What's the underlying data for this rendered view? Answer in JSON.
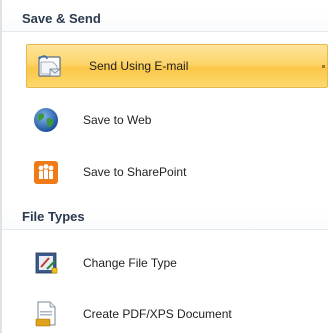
{
  "sections": [
    {
      "title": "Save & Send",
      "items": [
        {
          "label": "Send Using E-mail",
          "icon": "email-icon",
          "selected": true
        },
        {
          "label": "Save to Web",
          "icon": "globe-icon",
          "selected": false
        },
        {
          "label": "Save to SharePoint",
          "icon": "sharepoint-icon",
          "selected": false
        }
      ]
    },
    {
      "title": "File Types",
      "items": [
        {
          "label": "Change File Type",
          "icon": "change-file-type-icon",
          "selected": false
        },
        {
          "label": "Create PDF/XPS Document",
          "icon": "pdf-document-icon",
          "selected": false
        }
      ]
    }
  ],
  "colors": {
    "selected_highlight": "#fcd96d",
    "selected_border": "#e7b84b",
    "header_text": "#2b3a4e",
    "sharepoint_orange": "#f07a16"
  }
}
